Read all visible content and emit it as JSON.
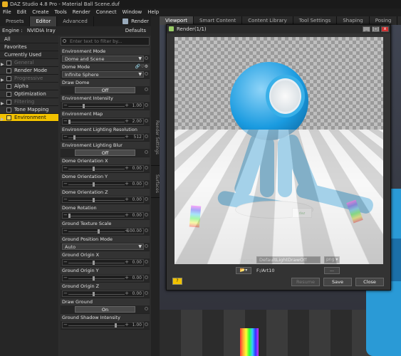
{
  "app": {
    "title": "DAZ Studio 4.8 Pro - Material Ball Scene.duf"
  },
  "menu": [
    "File",
    "Edit",
    "Create",
    "Tools",
    "Render",
    "Connect",
    "Window",
    "Help"
  ],
  "left_tabs": [
    "Presets",
    "Editor",
    "Advanced"
  ],
  "render_button": "Render",
  "engine": {
    "label": "Engine :",
    "value": "NVIDIA Iray",
    "defaults": "Defaults"
  },
  "categories": [
    {
      "label": "All",
      "sub": false,
      "dim": false,
      "sel": false,
      "tri": ""
    },
    {
      "label": "Favorites",
      "sub": false,
      "dim": false,
      "sel": false,
      "tri": ""
    },
    {
      "label": "Currently Used",
      "sub": false,
      "dim": false,
      "sel": false,
      "tri": ""
    },
    {
      "label": "General",
      "sub": true,
      "dim": true,
      "sel": false,
      "tri": "▶"
    },
    {
      "label": "Render Mode",
      "sub": true,
      "dim": false,
      "sel": false,
      "tri": ""
    },
    {
      "label": "Progressive Rend...",
      "sub": true,
      "dim": true,
      "sel": false,
      "tri": "▶"
    },
    {
      "label": "Alpha",
      "sub": true,
      "dim": false,
      "sel": false,
      "tri": ""
    },
    {
      "label": "Optimization",
      "sub": true,
      "dim": false,
      "sel": false,
      "tri": ""
    },
    {
      "label": "Filtering",
      "sub": true,
      "dim": true,
      "sel": false,
      "tri": "▶"
    },
    {
      "label": "Tone Mapping",
      "sub": true,
      "dim": false,
      "sel": false,
      "tri": ""
    },
    {
      "label": "Environment",
      "sub": true,
      "dim": false,
      "sel": true,
      "tri": "▶"
    }
  ],
  "filter_placeholder": "Enter text to filter by...",
  "properties": [
    {
      "label": "Environment Mode",
      "kind": "dropdown",
      "value": "Dome and Scene"
    },
    {
      "label": "Dome Mode",
      "kind": "dropdown",
      "value": "Infinite Sphere",
      "icons": "🔗♡⚙"
    },
    {
      "label": "Draw Dome",
      "kind": "toggle",
      "value": "Off"
    },
    {
      "label": "Environment Intensity",
      "kind": "slider",
      "value": "1.00",
      "level": 0.3
    },
    {
      "label": "Environment Map",
      "kind": "slider",
      "value": "2.00",
      "level": 0.0
    },
    {
      "label": "Environment Lighting Resolution",
      "kind": "slider",
      "value": "512",
      "level": 0.1
    },
    {
      "label": "Environment Lighting Blur",
      "kind": "toggle",
      "value": "Off"
    },
    {
      "label": "Dome Orientation X",
      "kind": "slider",
      "value": "0.00",
      "level": 0.5
    },
    {
      "label": "Dome Orientation Y",
      "kind": "slider",
      "value": "0.00",
      "level": 0.5
    },
    {
      "label": "Dome Orientation Z",
      "kind": "slider",
      "value": "0.00",
      "level": 0.5
    },
    {
      "label": "Dome Rotation",
      "kind": "slider",
      "value": "0.00",
      "level": 0.0
    },
    {
      "label": "Ground Texture Scale",
      "kind": "slider",
      "value": "100.00",
      "level": 0.6
    },
    {
      "label": "Ground Position Mode",
      "kind": "dropdown",
      "value": "Auto"
    },
    {
      "label": "Ground Origin X",
      "kind": "slider",
      "value": "0.00",
      "level": 0.5
    },
    {
      "label": "Ground Origin Y",
      "kind": "slider",
      "value": "0.00",
      "level": 0.5
    },
    {
      "label": "Ground Origin Z",
      "kind": "slider",
      "value": "0.00",
      "level": 0.5
    },
    {
      "label": "Draw Ground",
      "kind": "toggle",
      "value": "On"
    },
    {
      "label": "Ground Shadow Intensity",
      "kind": "slider",
      "value": "1.00",
      "level": 0.95
    }
  ],
  "side_tabs": [
    "Render Settings",
    "Surfaces"
  ],
  "viewport_tabs": [
    "Viewport",
    "Smart Content",
    "Content Library",
    "Tool Settings",
    "Shaping",
    "Posing"
  ],
  "render_window": {
    "title": "Render(1/1)",
    "name_label": "Name",
    "name_value": "DefaultLightDrawOff",
    "format": "png",
    "path": "F:/Art10",
    "browse": "...",
    "help": "?",
    "buttons": [
      "Resume",
      "Save",
      "Close"
    ],
    "sticker": "daz"
  }
}
